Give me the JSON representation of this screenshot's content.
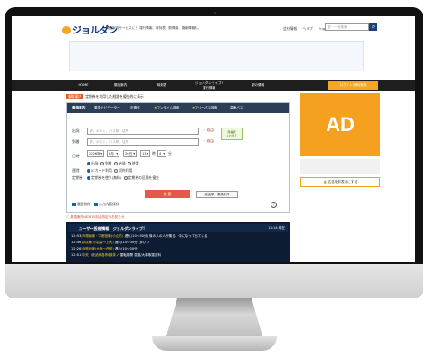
{
  "header": {
    "logo": "ジョルダン",
    "tagline": "乗換案内サービスに！ 運行情報、時刻表、駅情報、路線情報も。",
    "links": [
      "会社情報",
      "ヘルプ",
      "English"
    ],
    "search_placeholder": "駅・一言検索"
  },
  "nav": {
    "items": [
      "HOME",
      "乗換案内",
      "時刻表",
      "ジョルダンライブ!\n運行情報",
      "駅の情報"
    ],
    "login": "ログイン/無料登録"
  },
  "notice": {
    "label": "乗換案内",
    "text": "定期券を利用した経路を優先的に表示"
  },
  "form": {
    "tabs": [
      "乗換案内",
      "乗換ナビゲーター",
      "定期代",
      "ワンタイム検索",
      "フリーパス検索",
      "高速バス"
    ],
    "from_label": "出発",
    "to_label": "到着",
    "placeholder": "駅、ポスト、バス停、住所",
    "via_label": "＋ 経由",
    "swap_label": "発着駅\n入れ替え",
    "date_label": "日時",
    "year": "2026年",
    "month": "5月",
    "day": "20日",
    "hour": "13",
    "minute": "4",
    "time_types": [
      "出発",
      "到着",
      "始発",
      "終電"
    ],
    "fare_label": "運賃",
    "fare_options": [
      "ICカード利用",
      "切符利用"
    ],
    "commuter_label": "定期券",
    "commuter_options": [
      "定期券を使う(無料)",
      "定期券の区間を優先"
    ],
    "search_button": "検 索",
    "detail_button": "経由駅・乗換条件",
    "history_label": "履歴削除",
    "input_history": "入力内容保存"
  },
  "info_text": "乗換案内NEXTの料金改定のお知らせ",
  "news": {
    "title": "ユーザー投稿情報　ジョルダンライブ!",
    "time": "13:14 現在",
    "items": [
      {
        "time": "12:53",
        "line": "JR湘南線・宇都宮線(小山方)",
        "text": "遅れ(10～30分) 後の人の人が乗る、今になって出ている"
      },
      {
        "time": "12:46",
        "line": "京成線(小岩高～上大)",
        "text": "遅れ(10～30分) 多いい"
      },
      {
        "time": "12:26",
        "line": "JR神戸線(大阪～西宮)",
        "text": "遅れ(10～30分)"
      },
      {
        "time": "12:01",
        "line": "中央・総武線各停(御茶ノ",
        "text": "運転再開 混雑/大事故運送料"
      }
    ]
  },
  "ad": {
    "label": "AD",
    "link": "広告を非表示にする"
  },
  "colors": {
    "accent": "#f5a01e",
    "nav": "#1e1e1e",
    "tab_bar": "#2c3d56",
    "search_button": "#e8584a",
    "news_bg": "#0d1c33"
  }
}
